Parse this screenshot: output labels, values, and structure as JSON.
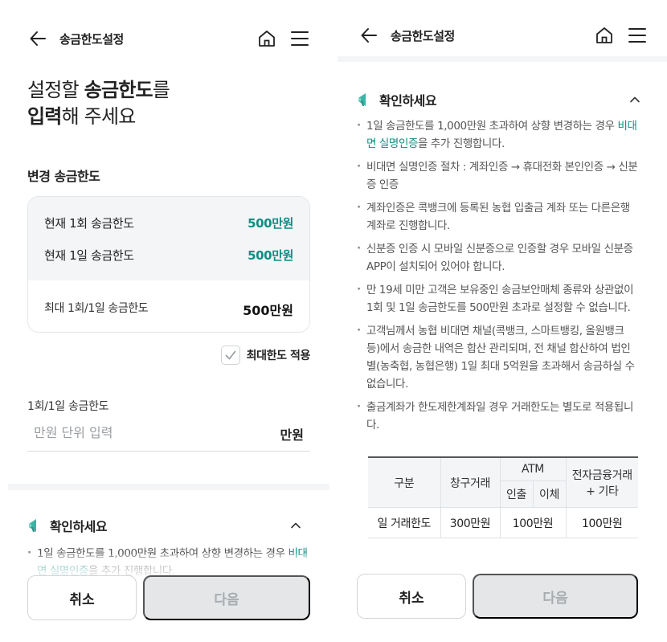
{
  "header": {
    "title": "송금한도설정"
  },
  "page": {
    "heading_line1_pre": "설정할 ",
    "heading_line1_bold": "송금한도",
    "heading_line1_post": "를",
    "heading_line2_bold": "입력",
    "heading_line2_post": "해 주세요",
    "section_title": "변경 송금한도"
  },
  "limits": {
    "current_once_label": "현재 1회 송금한도",
    "current_once_value": "500만원",
    "current_daily_label": "현재 1일 송금한도",
    "current_daily_value": "500만원",
    "max_label": "최대 1회/1일 송금한도",
    "max_value": "500만원"
  },
  "max_apply_label": "최대한도 적용",
  "input": {
    "label": "1회/1일 송금한도",
    "placeholder": "만원 단위 입력",
    "unit": "만원"
  },
  "notice": {
    "title": "확인하세요",
    "items": [
      {
        "text": "1일 송금한도를 1,000만원 초과하여 상향 변경하는 경우 ",
        "link": "비대면 실명인증",
        "after": "을 추가 진행합니다."
      },
      {
        "text": "비대면 실명인증 절차 : 계좌인증 → 휴대전화 본인인증 → 신분증 인증"
      },
      {
        "text": "계좌인증은 콕뱅크에 등록된 농협 입출금 계좌 또는 다른은행 계좌로 진행합니다."
      },
      {
        "text": "신분증 인증 시 모바일 신분증으로 인증할 경우 모바일 신분증 APP이 설치되어 있어야 합니다."
      },
      {
        "text": "만 19세 미만 고객은 보유중인 송금보안매체 종류와 상관없이 1회 및 1일 송금한도를 500만원 초과로 설정할 수 없습니다."
      },
      {
        "text": "고객님께서 농협 비대면 채널(콕뱅크, 스마트뱅킹, 올원뱅크 등)에서 송금한 내역은 합산 관리되며, 전 채널 합산하여 법인별(농축협, 농협은행) 1일 최대 5억원을 초과해서 송금하실 수 없습니다."
      },
      {
        "text": "출금계좌가 한도제한계좌일 경우 거래한도는 별도로 적용됩니다."
      }
    ],
    "table": {
      "h_type": "구분",
      "h_counter": "창구거래",
      "h_atm": "ATM",
      "h_withdraw": "인출",
      "h_transfer": "이체",
      "h_electronic": "전자금융거래 + 기타",
      "r_label": "일 거래한도",
      "r_counter": "300만원",
      "r_withdraw": "100만원",
      "r_electronic": "100만원"
    }
  },
  "buttons": {
    "cancel": "취소",
    "next": "다음"
  },
  "colors": {
    "accent": "#0e8f83",
    "disabled_bg": "#e4e6e8"
  },
  "icons": [
    "back-arrow-icon",
    "home-icon",
    "hamburger-menu-icon",
    "checkmark-icon",
    "megaphone-icon",
    "chevron-up-icon"
  ]
}
